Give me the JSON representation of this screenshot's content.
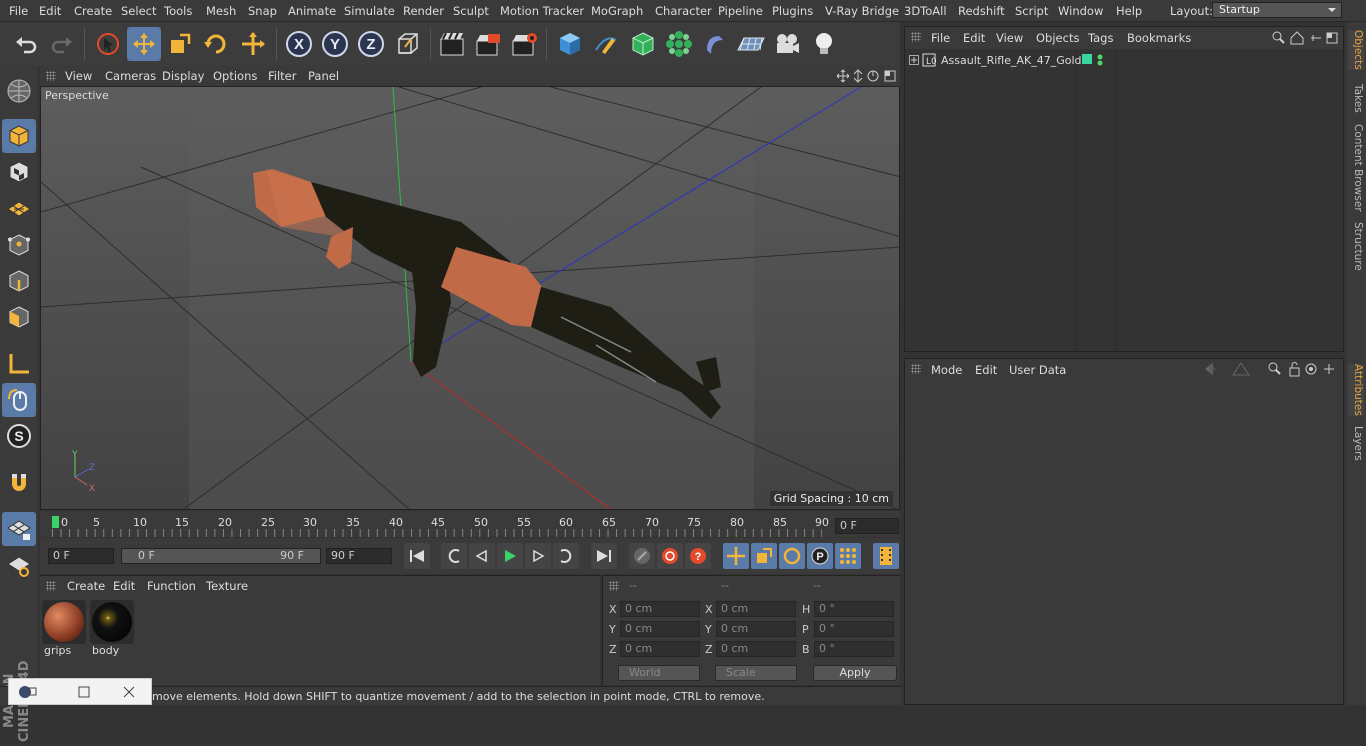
{
  "menu": [
    "File",
    "Edit",
    "Create",
    "Select",
    "Tools",
    "Mesh",
    "Snap",
    "Animate",
    "Simulate",
    "Render",
    "Sculpt",
    "Motion Tracker",
    "MoGraph",
    "Character",
    "Pipeline",
    "Plugins",
    "V-Ray Bridge",
    "3DToAll",
    "Redshift",
    "Script",
    "Window",
    "Help"
  ],
  "layout": {
    "label": "Layout:",
    "value": "Startup"
  },
  "viewport_menu": [
    "View",
    "Cameras",
    "Display",
    "Options",
    "Filter",
    "Panel"
  ],
  "viewport": {
    "label": "Perspective",
    "grid_spacing": "Grid Spacing : 10 cm"
  },
  "timeline": {
    "ticks": [
      "0",
      "5",
      "10",
      "15",
      "20",
      "25",
      "30",
      "35",
      "40",
      "45",
      "50",
      "55",
      "60",
      "65",
      "70",
      "75",
      "80",
      "85",
      "90"
    ],
    "current_frame": "0 F"
  },
  "playback": {
    "start": "0 F",
    "range_start": "0 F",
    "range_end": "90 F",
    "end": "90 F"
  },
  "material_menu": [
    "Create",
    "Edit",
    "Function",
    "Texture"
  ],
  "materials": [
    {
      "name": "grips"
    },
    {
      "name": "body"
    }
  ],
  "coords": {
    "headers": [
      "--",
      "--",
      "--"
    ],
    "rows": [
      {
        "l1": "X",
        "v1": "0 cm",
        "l2": "X",
        "v2": "0 cm",
        "l3": "H",
        "v3": "0 °"
      },
      {
        "l1": "Y",
        "v1": "0 cm",
        "l2": "Y",
        "v2": "0 cm",
        "l3": "P",
        "v3": "0 °"
      },
      {
        "l1": "Z",
        "v1": "0 cm",
        "l2": "Z",
        "v2": "0 cm",
        "l3": "B",
        "v3": "0 °"
      }
    ],
    "mode": "World",
    "type": "Scale",
    "apply": "Apply"
  },
  "status": "move elements. Hold down SHIFT to quantize movement / add to the selection in point mode, CTRL to remove.",
  "object_menu": [
    "File",
    "Edit",
    "View",
    "Objects",
    "Tags",
    "Bookmarks"
  ],
  "object": {
    "name": "Assault_Rifle_AK_47_Gold",
    "layer_color": "#3ad6a0"
  },
  "attr_menu": [
    "Mode",
    "Edit",
    "User Data"
  ],
  "right_tabs": [
    "Objects",
    "Takes",
    "Content Browser",
    "Structure",
    "Attributes",
    "Layers"
  ],
  "logo": "MAXON CINEMA 4D",
  "colors": {
    "accent": "#5a7aa8",
    "tab_active": "#e8a33a"
  }
}
